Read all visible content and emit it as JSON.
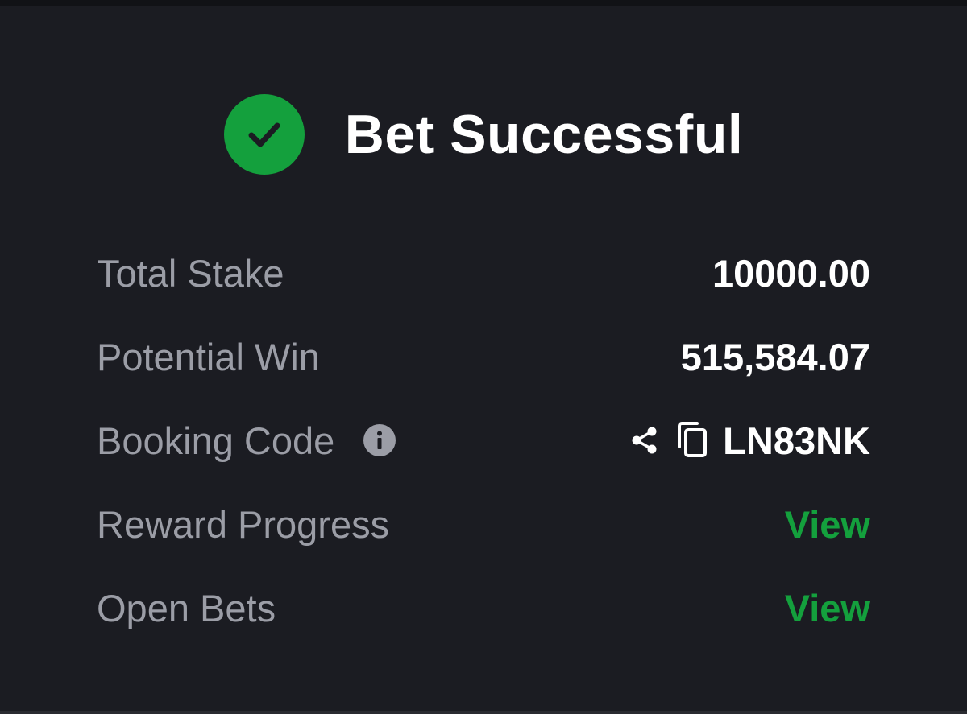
{
  "header": {
    "title": "Bet Successful",
    "icon": "check-circle-icon",
    "icon_color": "#14a03d"
  },
  "summary": {
    "total_stake": {
      "label": "Total Stake",
      "value": "10000.00"
    },
    "potential_win": {
      "label": "Potential Win",
      "value": "515,584.07"
    },
    "booking_code": {
      "label": "Booking Code",
      "value": "LN83NK",
      "icons": [
        "info-icon",
        "share-icon",
        "copy-icon"
      ]
    },
    "reward_progress": {
      "label": "Reward Progress",
      "action": "View"
    },
    "open_bets": {
      "label": "Open Bets",
      "action": "View"
    }
  },
  "colors": {
    "background": "#1b1c22",
    "accent": "#14a03d",
    "label": "#9b9da6",
    "value": "#ffffff"
  }
}
